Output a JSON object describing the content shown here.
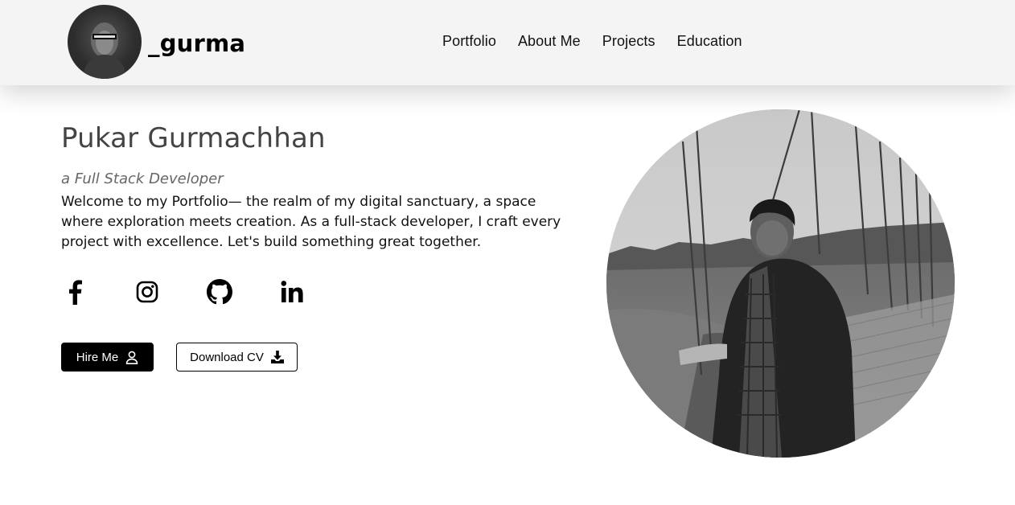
{
  "brand": {
    "name": "_gurma",
    "avatar_icon": "profile-avatar"
  },
  "nav": {
    "items": [
      {
        "label": "Portfolio"
      },
      {
        "label": "About Me"
      },
      {
        "label": "Projects"
      },
      {
        "label": "Education"
      }
    ]
  },
  "hero": {
    "name": "Pukar Gurmachhan",
    "role": "a Full Stack Developer",
    "description": "Welcome to my Portfolio— the realm of my digital sanctuary, a space where exploration meets creation. As a full-stack developer, I craft every project with excellence. Let's build something great together."
  },
  "socials": [
    {
      "icon": "facebook-icon"
    },
    {
      "icon": "instagram-icon"
    },
    {
      "icon": "github-icon"
    },
    {
      "icon": "linkedin-icon"
    }
  ],
  "buttons": {
    "hire_label": "Hire Me",
    "hire_icon": "user-icon",
    "cv_label": "Download CV",
    "cv_icon": "download-icon"
  },
  "colors": {
    "header_bg": "#f4f4f4",
    "primary": "#000000",
    "name_text": "#444444",
    "role_text": "#666666"
  }
}
